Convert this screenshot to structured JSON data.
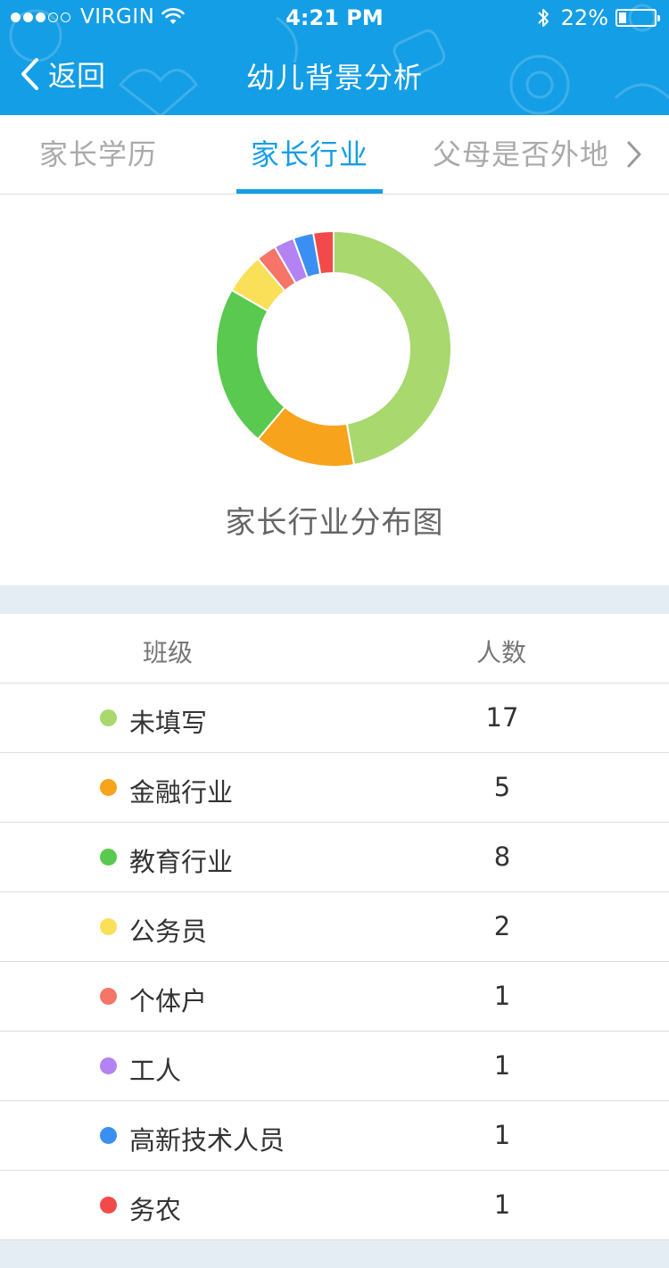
{
  "status_bar": {
    "carrier": "VIRGIN",
    "signal_bars_filled": 3,
    "signal_bars_total": 5,
    "time": "4:21 PM",
    "battery": "22%",
    "battery_level": 0.22,
    "icons": [
      "wifi-icon",
      "bluetooth-icon",
      "battery-icon"
    ]
  },
  "nav": {
    "back_label": "返回",
    "title": "幼儿背景分析",
    "bar_color": "#149ee6"
  },
  "tabs": [
    {
      "label": "家长学历",
      "active": false
    },
    {
      "label": "家长行业",
      "active": true
    },
    {
      "label": "父母是否外地",
      "active": false
    }
  ],
  "accent_color": "#149ee6",
  "chart_data": {
    "type": "pie",
    "style": "donut",
    "title": "家长行业分布图",
    "categories": [
      "未填写",
      "金融行业",
      "教育行业",
      "公务员",
      "个体户",
      "工人",
      "高新技术人员",
      "务农"
    ],
    "values": [
      17,
      5,
      8,
      2,
      1,
      1,
      1,
      1
    ],
    "colors": [
      "#a8d86e",
      "#f7a31c",
      "#5ac94f",
      "#f9e058",
      "#f77468",
      "#b383f4",
      "#3c8ff2",
      "#f24a4a"
    ]
  },
  "table": {
    "headers": [
      "班级",
      "人数"
    ],
    "rows": [
      {
        "label": "未填写",
        "count": "17"
      },
      {
        "label": "金融行业",
        "count": "5"
      },
      {
        "label": "教育行业",
        "count": "8"
      },
      {
        "label": "公务员",
        "count": "2"
      },
      {
        "label": "个体户",
        "count": "1"
      },
      {
        "label": "工人",
        "count": "1"
      },
      {
        "label": "高新技术人员",
        "count": "1"
      },
      {
        "label": "务农",
        "count": "1"
      }
    ]
  }
}
